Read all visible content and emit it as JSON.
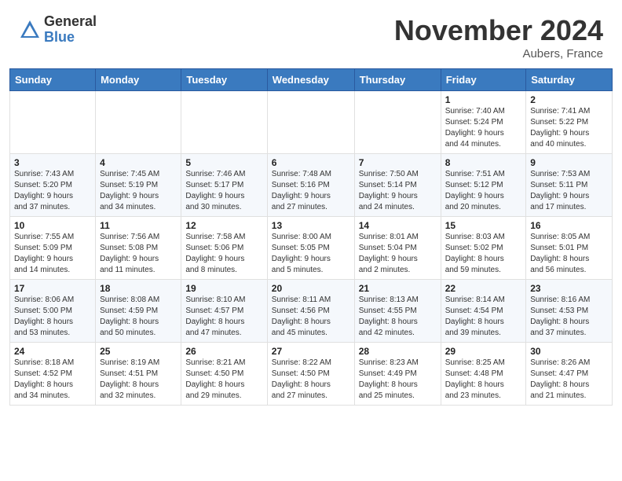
{
  "header": {
    "logo_general": "General",
    "logo_blue": "Blue",
    "title": "November 2024",
    "location": "Aubers, France"
  },
  "columns": [
    "Sunday",
    "Monday",
    "Tuesday",
    "Wednesday",
    "Thursday",
    "Friday",
    "Saturday"
  ],
  "weeks": [
    [
      {
        "day": "",
        "info": ""
      },
      {
        "day": "",
        "info": ""
      },
      {
        "day": "",
        "info": ""
      },
      {
        "day": "",
        "info": ""
      },
      {
        "day": "",
        "info": ""
      },
      {
        "day": "1",
        "info": "Sunrise: 7:40 AM\nSunset: 5:24 PM\nDaylight: 9 hours\nand 44 minutes."
      },
      {
        "day": "2",
        "info": "Sunrise: 7:41 AM\nSunset: 5:22 PM\nDaylight: 9 hours\nand 40 minutes."
      }
    ],
    [
      {
        "day": "3",
        "info": "Sunrise: 7:43 AM\nSunset: 5:20 PM\nDaylight: 9 hours\nand 37 minutes."
      },
      {
        "day": "4",
        "info": "Sunrise: 7:45 AM\nSunset: 5:19 PM\nDaylight: 9 hours\nand 34 minutes."
      },
      {
        "day": "5",
        "info": "Sunrise: 7:46 AM\nSunset: 5:17 PM\nDaylight: 9 hours\nand 30 minutes."
      },
      {
        "day": "6",
        "info": "Sunrise: 7:48 AM\nSunset: 5:16 PM\nDaylight: 9 hours\nand 27 minutes."
      },
      {
        "day": "7",
        "info": "Sunrise: 7:50 AM\nSunset: 5:14 PM\nDaylight: 9 hours\nand 24 minutes."
      },
      {
        "day": "8",
        "info": "Sunrise: 7:51 AM\nSunset: 5:12 PM\nDaylight: 9 hours\nand 20 minutes."
      },
      {
        "day": "9",
        "info": "Sunrise: 7:53 AM\nSunset: 5:11 PM\nDaylight: 9 hours\nand 17 minutes."
      }
    ],
    [
      {
        "day": "10",
        "info": "Sunrise: 7:55 AM\nSunset: 5:09 PM\nDaylight: 9 hours\nand 14 minutes."
      },
      {
        "day": "11",
        "info": "Sunrise: 7:56 AM\nSunset: 5:08 PM\nDaylight: 9 hours\nand 11 minutes."
      },
      {
        "day": "12",
        "info": "Sunrise: 7:58 AM\nSunset: 5:06 PM\nDaylight: 9 hours\nand 8 minutes."
      },
      {
        "day": "13",
        "info": "Sunrise: 8:00 AM\nSunset: 5:05 PM\nDaylight: 9 hours\nand 5 minutes."
      },
      {
        "day": "14",
        "info": "Sunrise: 8:01 AM\nSunset: 5:04 PM\nDaylight: 9 hours\nand 2 minutes."
      },
      {
        "day": "15",
        "info": "Sunrise: 8:03 AM\nSunset: 5:02 PM\nDaylight: 8 hours\nand 59 minutes."
      },
      {
        "day": "16",
        "info": "Sunrise: 8:05 AM\nSunset: 5:01 PM\nDaylight: 8 hours\nand 56 minutes."
      }
    ],
    [
      {
        "day": "17",
        "info": "Sunrise: 8:06 AM\nSunset: 5:00 PM\nDaylight: 8 hours\nand 53 minutes."
      },
      {
        "day": "18",
        "info": "Sunrise: 8:08 AM\nSunset: 4:59 PM\nDaylight: 8 hours\nand 50 minutes."
      },
      {
        "day": "19",
        "info": "Sunrise: 8:10 AM\nSunset: 4:57 PM\nDaylight: 8 hours\nand 47 minutes."
      },
      {
        "day": "20",
        "info": "Sunrise: 8:11 AM\nSunset: 4:56 PM\nDaylight: 8 hours\nand 45 minutes."
      },
      {
        "day": "21",
        "info": "Sunrise: 8:13 AM\nSunset: 4:55 PM\nDaylight: 8 hours\nand 42 minutes."
      },
      {
        "day": "22",
        "info": "Sunrise: 8:14 AM\nSunset: 4:54 PM\nDaylight: 8 hours\nand 39 minutes."
      },
      {
        "day": "23",
        "info": "Sunrise: 8:16 AM\nSunset: 4:53 PM\nDaylight: 8 hours\nand 37 minutes."
      }
    ],
    [
      {
        "day": "24",
        "info": "Sunrise: 8:18 AM\nSunset: 4:52 PM\nDaylight: 8 hours\nand 34 minutes."
      },
      {
        "day": "25",
        "info": "Sunrise: 8:19 AM\nSunset: 4:51 PM\nDaylight: 8 hours\nand 32 minutes."
      },
      {
        "day": "26",
        "info": "Sunrise: 8:21 AM\nSunset: 4:50 PM\nDaylight: 8 hours\nand 29 minutes."
      },
      {
        "day": "27",
        "info": "Sunrise: 8:22 AM\nSunset: 4:50 PM\nDaylight: 8 hours\nand 27 minutes."
      },
      {
        "day": "28",
        "info": "Sunrise: 8:23 AM\nSunset: 4:49 PM\nDaylight: 8 hours\nand 25 minutes."
      },
      {
        "day": "29",
        "info": "Sunrise: 8:25 AM\nSunset: 4:48 PM\nDaylight: 8 hours\nand 23 minutes."
      },
      {
        "day": "30",
        "info": "Sunrise: 8:26 AM\nSunset: 4:47 PM\nDaylight: 8 hours\nand 21 minutes."
      }
    ]
  ]
}
